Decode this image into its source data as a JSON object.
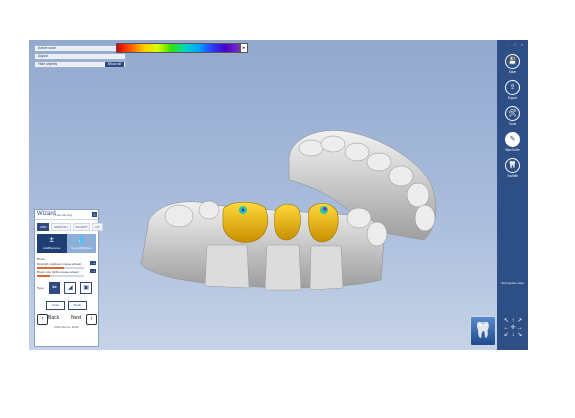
{
  "top_panel": {
    "rows": [
      "Active scan",
      "Adjust",
      "Hide objects"
    ],
    "show_all": "Show all"
  },
  "colorbar": {
    "button": "▸",
    "colors": [
      "#d40000",
      "#ff5a00",
      "#ffcc00",
      "#d8ff00",
      "#35e000",
      "#00d8c0",
      "#00a8ff",
      "#2a3cff",
      "#4b00c8",
      "#7b2bd0"
    ]
  },
  "sidebar": {
    "window_controls": "- □ ×",
    "tools": [
      {
        "label": "Save",
        "icon": "save-icon",
        "glyph": "💾"
      },
      {
        "label": "Export",
        "icon": "export-icon",
        "glyph": "⇪"
      },
      {
        "label": "Tools",
        "icon": "tools-icon",
        "glyph": "🛠"
      },
      {
        "label": "Wax Knife",
        "icon": "wax-knife-icon",
        "glyph": "✎"
      },
      {
        "label": "Toothlib",
        "icon": "tooth-library-icon",
        "glyph": "🦷"
      }
    ],
    "view_label": "Soft system view",
    "arrows": [
      [
        "↖",
        "↑",
        "↗"
      ],
      [
        "←",
        "✛",
        "→"
      ],
      [
        "↙",
        "↓",
        "↘"
      ]
    ],
    "tooth_button_glyph": "🦷"
  },
  "wizard": {
    "title": "Wizard",
    "subtitle": "Free forming",
    "close": "×",
    "tabs": [
      "ADD",
      "SMOOTH",
      "SCULPT",
      "FIT"
    ],
    "modes": [
      {
        "label": "Add/Remove",
        "glyph": "±"
      },
      {
        "label": "Smooth/Flatten",
        "glyph": "💧"
      }
    ],
    "section": "Brush",
    "sliders": [
      {
        "label": "Strength (up/down mouse wheel)",
        "value": 0.58,
        "plus_minus": "- +"
      },
      {
        "label": "Brush size (shift+mouse wheel)",
        "value": 0.28,
        "plus_minus": "- +"
      }
    ],
    "type_label": "Type",
    "type_buttons": [
      {
        "glyph": "✏",
        "active": true
      },
      {
        "glyph": "◢",
        "active": false
      },
      {
        "glyph": "▣",
        "active": false
      }
    ],
    "undo_label": "Undo",
    "redo_label": "Redo",
    "back_label": "Back",
    "next_label": "Next",
    "hint": "Click Next to finish"
  },
  "model": {
    "gum_color": "#c9c9c9",
    "crown_color": "#e7b400"
  }
}
